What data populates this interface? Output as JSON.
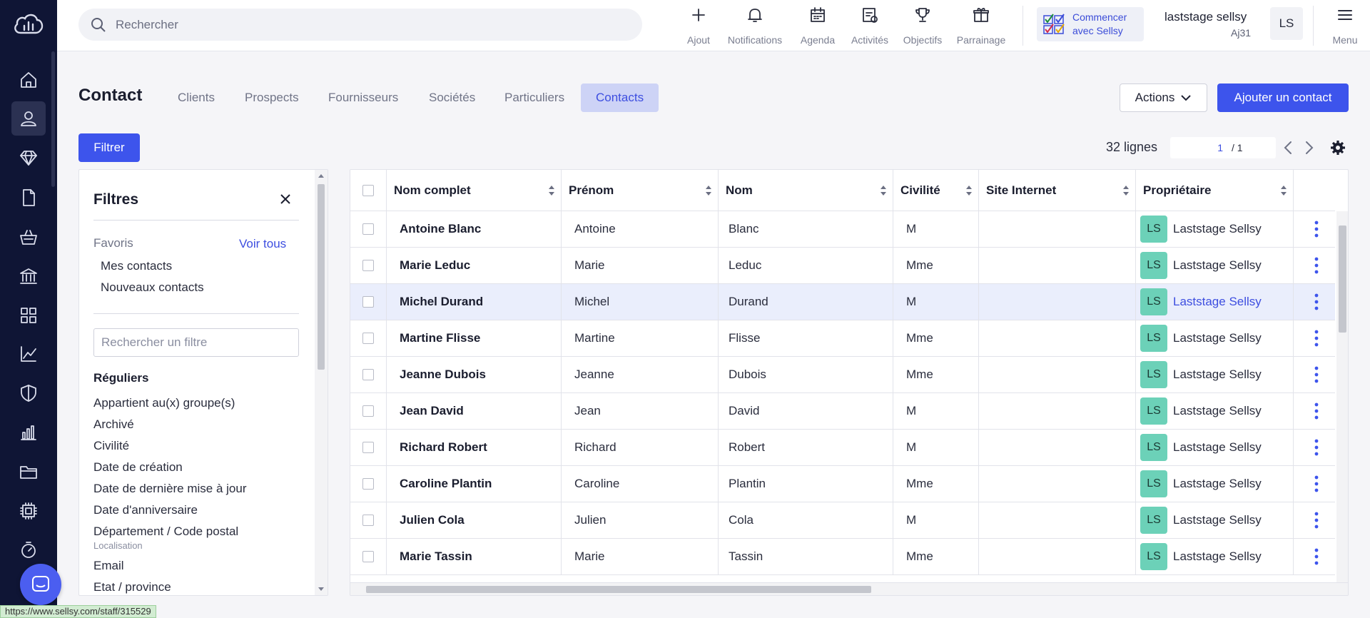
{
  "search": {
    "placeholder": "Rechercher"
  },
  "toolbar": {
    "ajout": "Ajout",
    "notifications": "Notifications",
    "agenda": "Agenda",
    "activites": "Activités",
    "objectifs": "Objectifs",
    "parrainage": "Parrainage",
    "start_line1": "Commencer",
    "start_line2": "avec Sellsy",
    "user_name": "laststage sellsy",
    "user_sub": "Aj31",
    "avatar": "LS",
    "menu": "Menu"
  },
  "page": {
    "title": "Contact",
    "tabs": [
      "Clients",
      "Prospects",
      "Fournisseurs",
      "Sociétés",
      "Particuliers",
      "Contacts"
    ],
    "active_tab": "Contacts",
    "actions": "Actions",
    "add_contact": "Ajouter un contact",
    "filter_button": "Filtrer",
    "lines": "32 lignes",
    "page_current": "1",
    "page_total": "/ 1"
  },
  "filters": {
    "title": "Filtres",
    "favoris_label": "Favoris",
    "voir_tous": "Voir tous",
    "favoris": [
      "Mes contacts",
      "Nouveaux contacts"
    ],
    "search_placeholder": "Rechercher un filtre",
    "section": "Réguliers",
    "items": [
      "Appartient au(x) groupe(s)",
      "Archivé",
      "Civilité",
      "Date de création",
      "Date de dernière mise à jour",
      "Date d'anniversaire",
      "Département / Code postal",
      "Email",
      "Etat / province"
    ],
    "sub_localisation": "Localisation"
  },
  "table": {
    "headers": [
      "Nom complet",
      "Prénom",
      "Nom",
      "Civilité",
      "Site Internet",
      "Propriétaire"
    ],
    "rows": [
      {
        "full": "Antoine Blanc",
        "first": "Antoine",
        "last": "Blanc",
        "civ": "M",
        "site": "",
        "badge": "LS",
        "owner": "Laststage Sellsy"
      },
      {
        "full": "Marie Leduc",
        "first": "Marie",
        "last": "Leduc",
        "civ": "Mme",
        "site": "",
        "badge": "LS",
        "owner": "Laststage Sellsy"
      },
      {
        "full": "Michel Durand",
        "first": "Michel",
        "last": "Durand",
        "civ": "M",
        "site": "",
        "badge": "LS",
        "owner": "Laststage Sellsy"
      },
      {
        "full": "Martine Flisse",
        "first": "Martine",
        "last": "Flisse",
        "civ": "Mme",
        "site": "",
        "badge": "LS",
        "owner": "Laststage Sellsy"
      },
      {
        "full": "Jeanne Dubois",
        "first": "Jeanne",
        "last": "Dubois",
        "civ": "Mme",
        "site": "",
        "badge": "LS",
        "owner": "Laststage Sellsy"
      },
      {
        "full": "Jean David",
        "first": "Jean",
        "last": "David",
        "civ": "M",
        "site": "",
        "badge": "LS",
        "owner": "Laststage Sellsy"
      },
      {
        "full": "Richard Robert",
        "first": "Richard",
        "last": "Robert",
        "civ": "M",
        "site": "",
        "badge": "LS",
        "owner": "Laststage Sellsy"
      },
      {
        "full": "Caroline Plantin",
        "first": "Caroline",
        "last": "Plantin",
        "civ": "Mme",
        "site": "",
        "badge": "LS",
        "owner": "Laststage Sellsy"
      },
      {
        "full": "Julien Cola",
        "first": "Julien",
        "last": "Cola",
        "civ": "M",
        "site": "",
        "badge": "LS",
        "owner": "Laststage Sellsy"
      },
      {
        "full": "Marie Tassin",
        "first": "Marie",
        "last": "Tassin",
        "civ": "Mme",
        "site": "",
        "badge": "LS",
        "owner": "Laststage Sellsy"
      }
    ],
    "highlighted_row": "Michel Durand"
  },
  "statusbar": {
    "url": "https://www.sellsy.com/staff/315529"
  },
  "colors": {
    "nav_bg": "#0f1535",
    "accent": "#3d54ec",
    "badge": "#6cd1b8",
    "active_tab_bg": "#cdd3f6"
  }
}
